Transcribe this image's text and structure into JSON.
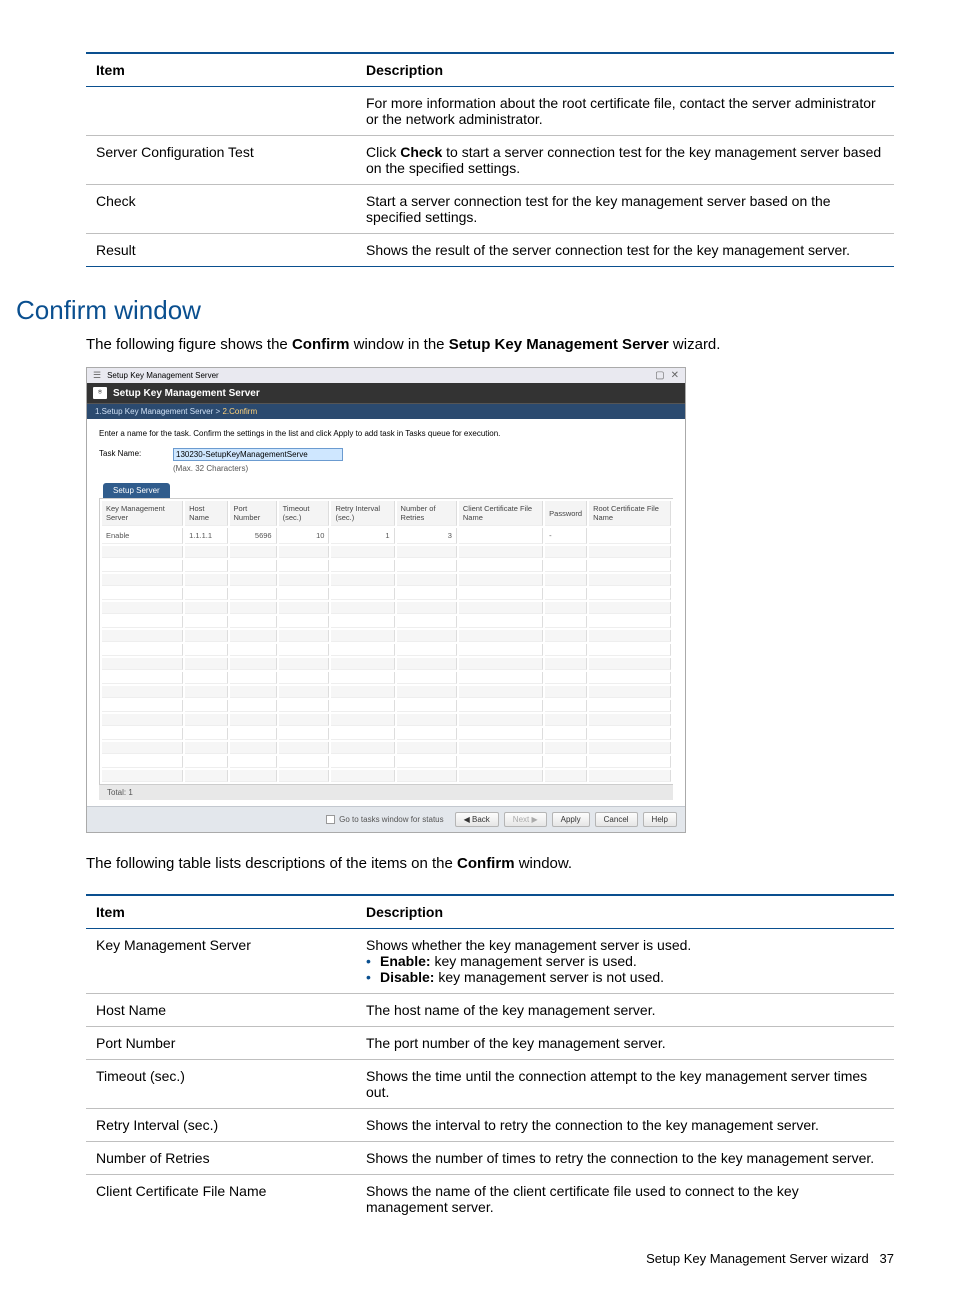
{
  "table1": {
    "head_item": "Item",
    "head_desc": "Description",
    "rows": [
      {
        "item": "",
        "desc": "For more information about the root certificate file, contact the server administrator or the network administrator."
      },
      {
        "item": "Server Configuration Test",
        "desc_pre": "Click ",
        "desc_bold": "Check",
        "desc_post": " to start a server connection test for the key management server based on the specified settings."
      },
      {
        "item": "Check",
        "desc": "Start a server connection test for the key management server based on the specified settings."
      },
      {
        "item": "Result",
        "desc": "Shows the result of the server connection test for the key management server."
      }
    ]
  },
  "section_heading": "Confirm window",
  "intro": {
    "pre": "The following figure shows the ",
    "b1": "Confirm",
    "mid": " window in the ",
    "b2": "Setup Key Management Server",
    "post": " wizard."
  },
  "wizard": {
    "outer_title": "Setup Key Management Server",
    "banner_title": "Setup Key Management Server",
    "breadcrumb_step1": "1.Setup Key Management Server",
    "breadcrumb_sep": ">",
    "breadcrumb_step2": "2.Confirm",
    "instruction": "Enter a name for the task. Confirm the settings in the list and click Apply to add task in Tasks queue for execution.",
    "task_label": "Task Name:",
    "task_value": "130230-SetupKeyManagementServe",
    "task_hint": "(Max. 32 Characters)",
    "tab_label": "Setup Server",
    "columns": {
      "c0": "Key Management Server",
      "c1": "Host Name",
      "c2": "Port Number",
      "c3": "Timeout (sec.)",
      "c4": "Retry Interval (sec.)",
      "c5": "Number of Retries",
      "c6": "Client Certificate File Name",
      "c7": "Password",
      "c8": "Root Certificate File Name"
    },
    "row": {
      "c0": "Enable",
      "c1": "1.1.1.1",
      "c2": "5696",
      "c3": "10",
      "c4": "1",
      "c5": "3",
      "c6": "",
      "c7": "-",
      "c8": ""
    },
    "total_label": "Total: 1",
    "goto_label": "Go to tasks window for status",
    "buttons": {
      "back": "◀ Back",
      "next": "Next ▶",
      "apply": "Apply",
      "cancel": "Cancel",
      "help": "Help"
    }
  },
  "between": {
    "pre": "The following table lists descriptions of the items on the ",
    "b": "Confirm",
    "post": " window."
  },
  "table2": {
    "head_item": "Item",
    "head_desc": "Description",
    "rows": {
      "r0": {
        "item": "Key Management Server",
        "line0": "Shows whether the key management server is used.",
        "bullet0_b": "Enable:",
        "bullet0_t": " key management server is used.",
        "bullet1_b": "Disable:",
        "bullet1_t": " key management server is not used."
      },
      "r1": {
        "item": "Host Name",
        "desc": "The host name of the key management server."
      },
      "r2": {
        "item": "Port Number",
        "desc": "The port number of the key management server."
      },
      "r3": {
        "item": "Timeout (sec.)",
        "desc": "Shows the time until the connection attempt to the key management server times out."
      },
      "r4": {
        "item": "Retry Interval (sec.)",
        "desc": "Shows the interval to retry the connection to the key management server."
      },
      "r5": {
        "item": "Number of Retries",
        "desc": "Shows the number of times to retry the connection to the key management server."
      },
      "r6": {
        "item": "Client Certificate File Name",
        "desc": "Shows the name of the client certificate file used to connect to the key management server."
      }
    }
  },
  "footer": {
    "text": "Setup Key Management Server wizard",
    "page": "37"
  }
}
